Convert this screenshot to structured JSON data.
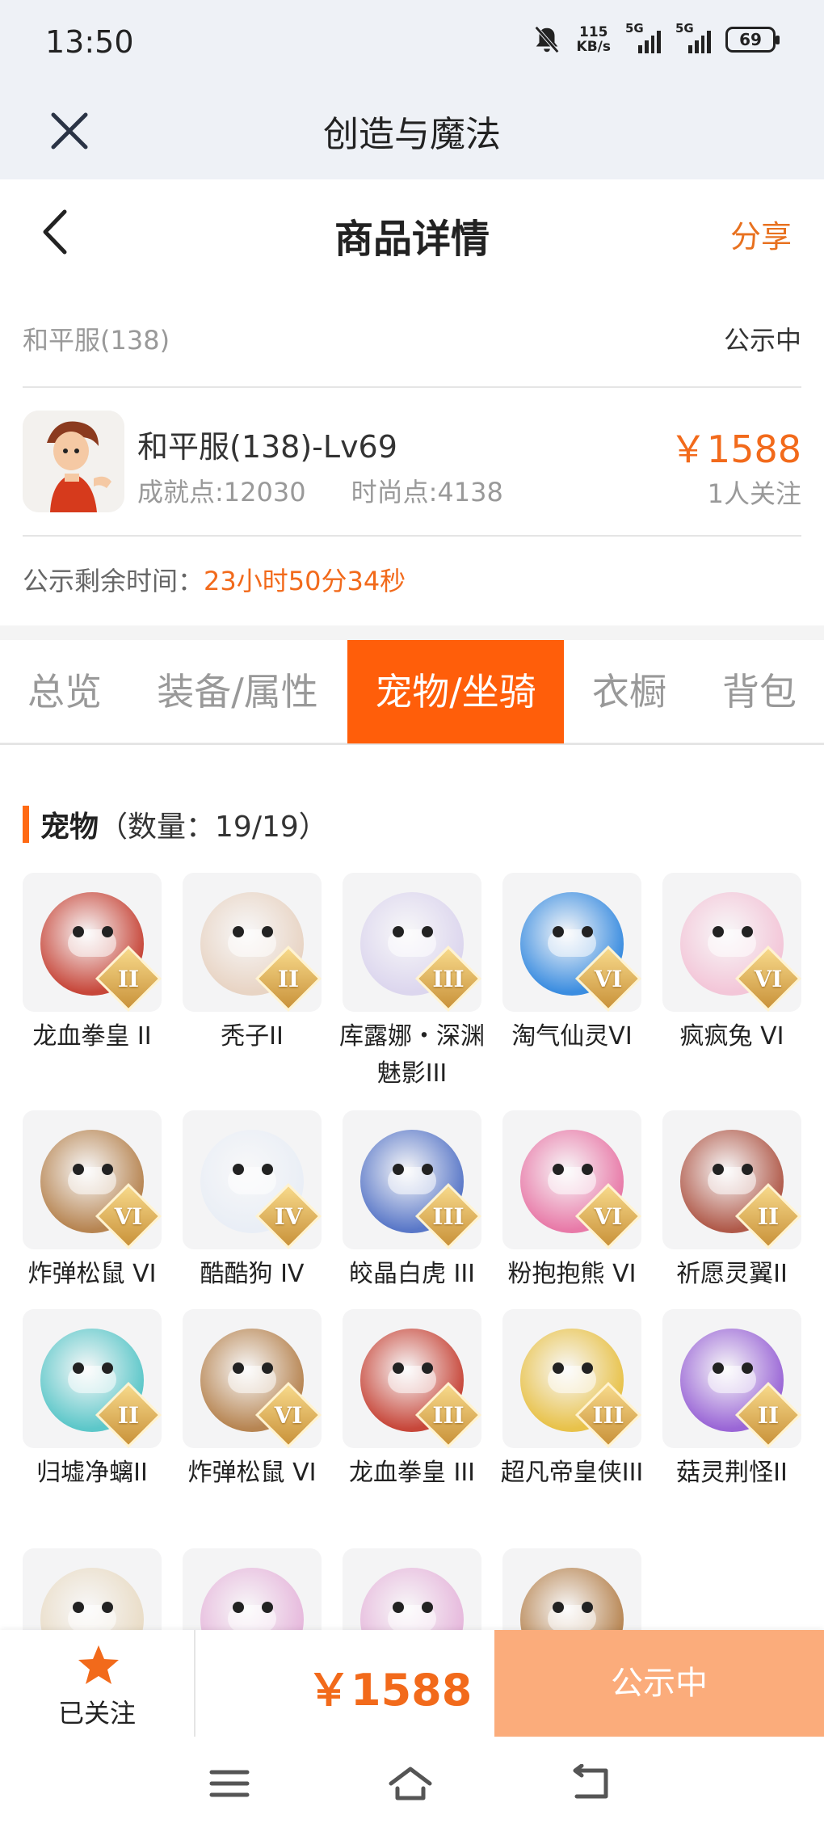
{
  "status_bar": {
    "time": "13:50",
    "net_speed_value": "115",
    "net_speed_unit": "KB/s",
    "signal1_label": "5G",
    "signal2_label": "5G",
    "battery": "69"
  },
  "mini_header": {
    "title": "创造与魔法"
  },
  "page_nav": {
    "title": "商品详情",
    "share": "分享"
  },
  "info": {
    "server": "和平服(138)",
    "status": "公示中",
    "char_name": "和平服(138)-Lv69",
    "achievement": "成就点:12030",
    "fashion": "时尚点:4138",
    "price": "￥1588",
    "follows": "1人关注",
    "timer_label": "公示剩余时间：",
    "timer_value": "23小时50分34秒"
  },
  "tabs": [
    "总览",
    "装备/属性",
    "宠物/坐骑",
    "衣橱",
    "背包"
  ],
  "section": {
    "title": "宠物",
    "count": "（数量：19/19）"
  },
  "pets": [
    {
      "name": "龙血拳皇 II",
      "grade": "II",
      "color": "#c7473a"
    },
    {
      "name": "秃子II",
      "grade": "II",
      "color": "#e8d4c4"
    },
    {
      "name": "库露娜・深渊魅影III",
      "grade": "III",
      "color": "#dcd6ee"
    },
    {
      "name": "淘气仙灵VI",
      "grade": "VI",
      "color": "#3b8de0"
    },
    {
      "name": "疯疯兔 VI",
      "grade": "VI",
      "color": "#f3c6d8"
    },
    {
      "name": "炸弹松鼠 VI",
      "grade": "VI",
      "color": "#b78552"
    },
    {
      "name": "酷酷狗 IV",
      "grade": "IV",
      "color": "#e9eef6"
    },
    {
      "name": "皎晶白虎 III",
      "grade": "III",
      "color": "#5a78c8"
    },
    {
      "name": "粉抱抱熊 VI",
      "grade": "VI",
      "color": "#e87aa8"
    },
    {
      "name": "祈愿灵翼II",
      "grade": "II",
      "color": "#b05a4a"
    },
    {
      "name": "归墟净螭II",
      "grade": "II",
      "color": "#5cc7c9"
    },
    {
      "name": "炸弹松鼠 VI",
      "grade": "VI",
      "color": "#b78552"
    },
    {
      "name": "龙血拳皇 III",
      "grade": "III",
      "color": "#c7473a"
    },
    {
      "name": "超凡帝皇侠III",
      "grade": "III",
      "color": "#e8c24a"
    },
    {
      "name": "菇灵荆怪II",
      "grade": "II",
      "color": "#9a66d6"
    },
    {
      "name": "",
      "grade": "",
      "color": "#e9dcc6"
    },
    {
      "name": "",
      "grade": "",
      "color": "#e6b8dc"
    },
    {
      "name": "",
      "grade": "",
      "color": "#e6b8dc"
    },
    {
      "name": "",
      "grade": "",
      "color": "#b78552"
    }
  ],
  "action_bar": {
    "follow_label": "已关注",
    "price": "￥1588",
    "buy_label": "公示中"
  },
  "colors": {
    "accent": "#f26a1b",
    "tab_active": "#ff5e0a",
    "buy_button": "#fbac7b"
  }
}
